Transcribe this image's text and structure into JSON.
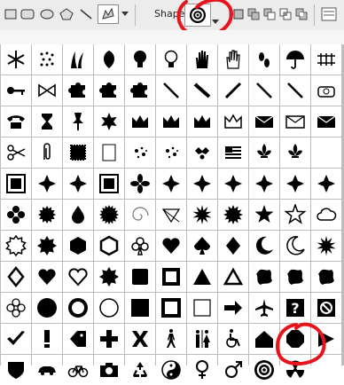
{
  "toolbar": {
    "shape_label": "Shape:",
    "tools": [
      "rectangle-tool",
      "rounded-rectangle-tool",
      "ellipse-tool",
      "polygon-tool",
      "line-tool",
      "custom-shape-tool"
    ],
    "selected_shape": "target-icon",
    "combine_modes": [
      "new-shape-mode",
      "add-shape-mode",
      "subtract-shape-mode",
      "intersect-shape-mode",
      "exclude-shape-mode"
    ],
    "annotation_color": "#e8141c"
  },
  "shape_library": {
    "rows": [
      [
        "snowflake-icon",
        "dots-icon",
        "grass-icon",
        "leaf-icon",
        "bulb-icon",
        "lightbulb-outline-icon",
        "hand-icon",
        "hand-outline-icon",
        "footprint-icon",
        "umbrella-icon",
        "rail-icon"
      ],
      [
        "key-icon",
        "bow-icon",
        "puzzle-piece-icon",
        "puzzle-piece-icon",
        "puzzle-piece-icon",
        "slash-icon",
        "pen-nib-icon",
        "pencil-icon",
        "slash-icon",
        "slash-icon",
        "phone-outline-icon"
      ],
      [
        "telephone-icon",
        "hourglass-icon",
        "pushpin-icon",
        "star-badge-icon",
        "crown-icon",
        "crown-icon",
        "crown-icon",
        "diamond-crown-icon",
        "envelope-icon",
        "envelope-outline-icon",
        "envelope-icon"
      ],
      [
        "scissors-icon",
        "paperclip-icon",
        "stamp-icon",
        "paper-icon",
        "splatter-icon",
        "splatter-icon",
        "holly-icon",
        "flag-icon",
        "fleur-de-lis-icon",
        "fleur-de-lis-icon",
        "blank-icon"
      ],
      [
        "ornament-frame-icon",
        "ornament-icon",
        "ornament-icon",
        "ornament-frame-icon",
        "flower-ornament-icon",
        "ornament-icon",
        "ornament-icon",
        "ornament-icon",
        "ornament-icon",
        "ornament-icon",
        "ornament-icon"
      ],
      [
        "flower-icon",
        "hedgehog-icon",
        "droplet-icon",
        "seal-icon",
        "spiral-icon",
        "triangle-swoosh-icon",
        "starburst-icon",
        "sun-icon",
        "star-icon",
        "star-outline-icon",
        "cloud-icon"
      ],
      [
        "burst-outline-icon",
        "burst-icon",
        "hexagon-icon",
        "hexagon-outline-icon",
        "club-icon",
        "heart-icon",
        "spade-icon",
        "diamond-card-icon",
        "moon-icon",
        "moon-outline-icon",
        "starburst-icon"
      ],
      [
        "diamond-outline-icon",
        "heart-icon",
        "heart-outline-icon",
        "burst-icon",
        "rounded-square-icon",
        "square-outline-icon",
        "triangle-icon",
        "triangle-outline-icon",
        "blob-icon",
        "blob-icon",
        "blob-icon"
      ],
      [
        "flower-outline-icon",
        "circle-icon",
        "circle-thick-icon",
        "circle-outline-icon",
        "square-icon",
        "square-frame-icon",
        "square-thin-icon",
        "arrow-right-icon",
        "airplane-icon",
        "question-icon",
        "no-icon"
      ],
      [
        "checkmark-icon",
        "exclamation-icon",
        "tag-icon",
        "cross-icon",
        "x-mark-icon",
        "pedestrian-icon",
        "restroom-icon",
        "wheelchair-icon",
        "house-icon",
        "octagon-icon",
        "arrow-icon"
      ],
      [
        "shield-icon",
        "car-icon",
        "bicycle-icon",
        "camera-icon",
        "recycle-icon",
        "yin-yang-icon",
        "female-icon",
        "male-icon",
        "target-icon",
        "radiation-icon",
        "blank-icon"
      ]
    ]
  }
}
